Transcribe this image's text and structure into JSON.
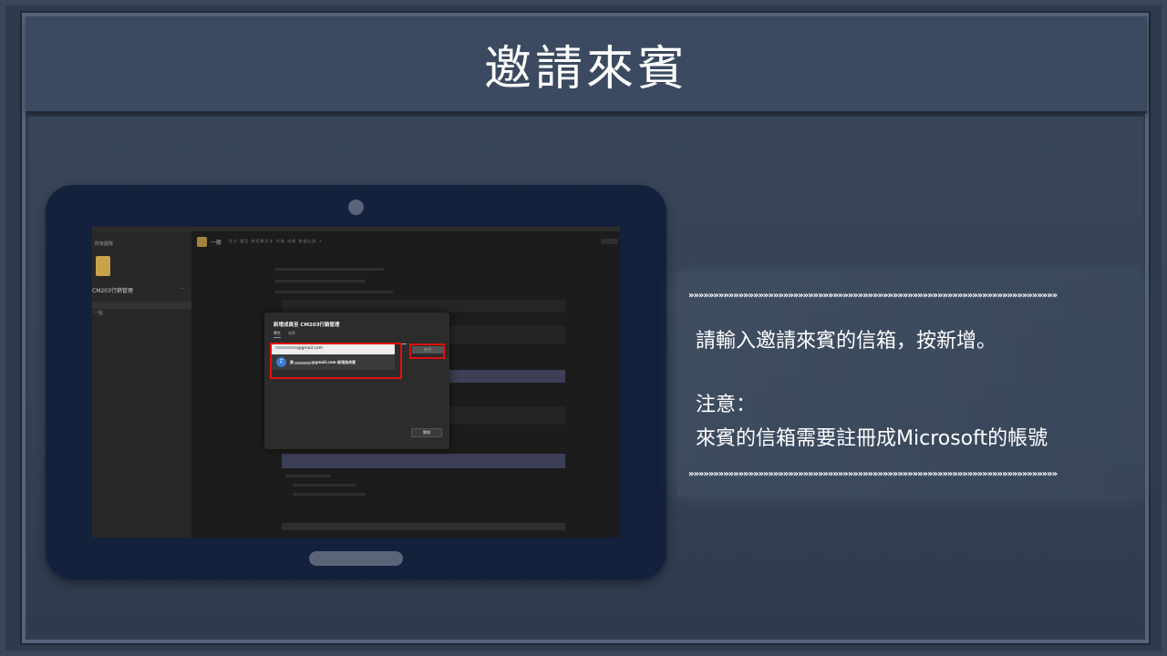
{
  "slide": {
    "title": "邀請來賓"
  },
  "screenshot": {
    "sidebar": {
      "title": "所有團隊",
      "team_name": "CM203行銷管理",
      "team_more": "···",
      "channel": "一般"
    },
    "header": {
      "channel_name": "一般",
      "tabs": "貼文 檔案 課程筆記本 作業 成績 會議記錄 +"
    },
    "dialog": {
      "title": "新增成員至 CM203行銷管理",
      "tab_members": "學生",
      "tab_owners": "老師",
      "input_value": "@gmail.com",
      "suggestion_text": "@gmail.com 新增為來賓",
      "suggestion_prefix": "將",
      "avatar_initial": "Z",
      "add_button": "新增",
      "close_button": "關閉"
    }
  },
  "instructions": {
    "line1": "請輸入邀請來賓的信箱，按新增。",
    "line2": "注意：",
    "line3": "來賓的信箱需要註冊成Microsoft的帳號",
    "divider": "»»»»»»»»»»»»»»»»»»»»»»»»»»»»»»»»»»»»»»»»»»»»»»»»»»»»»»»»»»»»»»»»»»»»»»»»»»»»»»»»»»»»»»»»»»»»»»»»»»»»»»»»»»»»»»»»»»"
  },
  "colors": {
    "background": "#2b3546",
    "title_bar": "#3b4a60",
    "tablet": "#14213d",
    "highlight": "#e01010",
    "text": "#ffffff"
  }
}
